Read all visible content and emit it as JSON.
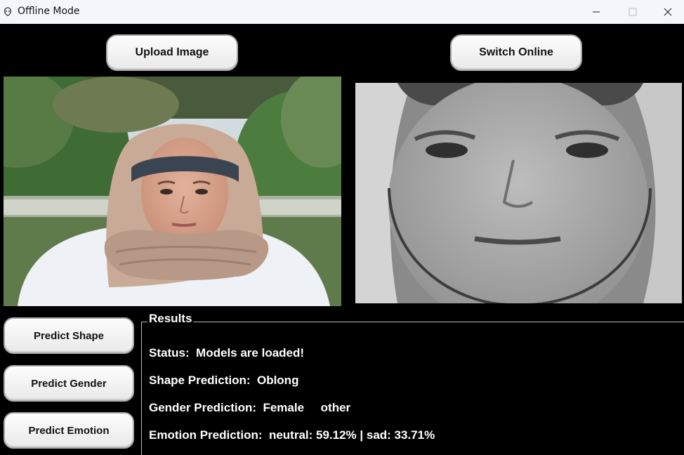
{
  "window": {
    "title": "Offline Mode",
    "icons": {
      "app": "feather-icon",
      "minimize": "minimize-icon",
      "maximize": "maximize-icon",
      "close": "close-icon"
    }
  },
  "toolbar": {
    "upload_label": "Upload Image",
    "switch_label": "Switch Online"
  },
  "images": {
    "original": {
      "kind": "photo-woman-hijab"
    },
    "processed": {
      "kind": "grayscale-face-crop"
    }
  },
  "side_buttons": {
    "predict_shape": "Predict Shape",
    "predict_gender": "Predict Gender",
    "predict_emotion": "Predict Emotion"
  },
  "results": {
    "legend": "Results",
    "status": "Status:  Models are loaded!",
    "shape": "Shape Prediction:  Oblong",
    "gender": "Gender Prediction:  Female     other",
    "emotion": "Emotion Prediction:  neutral: 59.12% | sad: 33.71%"
  },
  "colors": {
    "background": "#000000",
    "titlebar": "#f3f6fa",
    "text": "#ffffff"
  }
}
